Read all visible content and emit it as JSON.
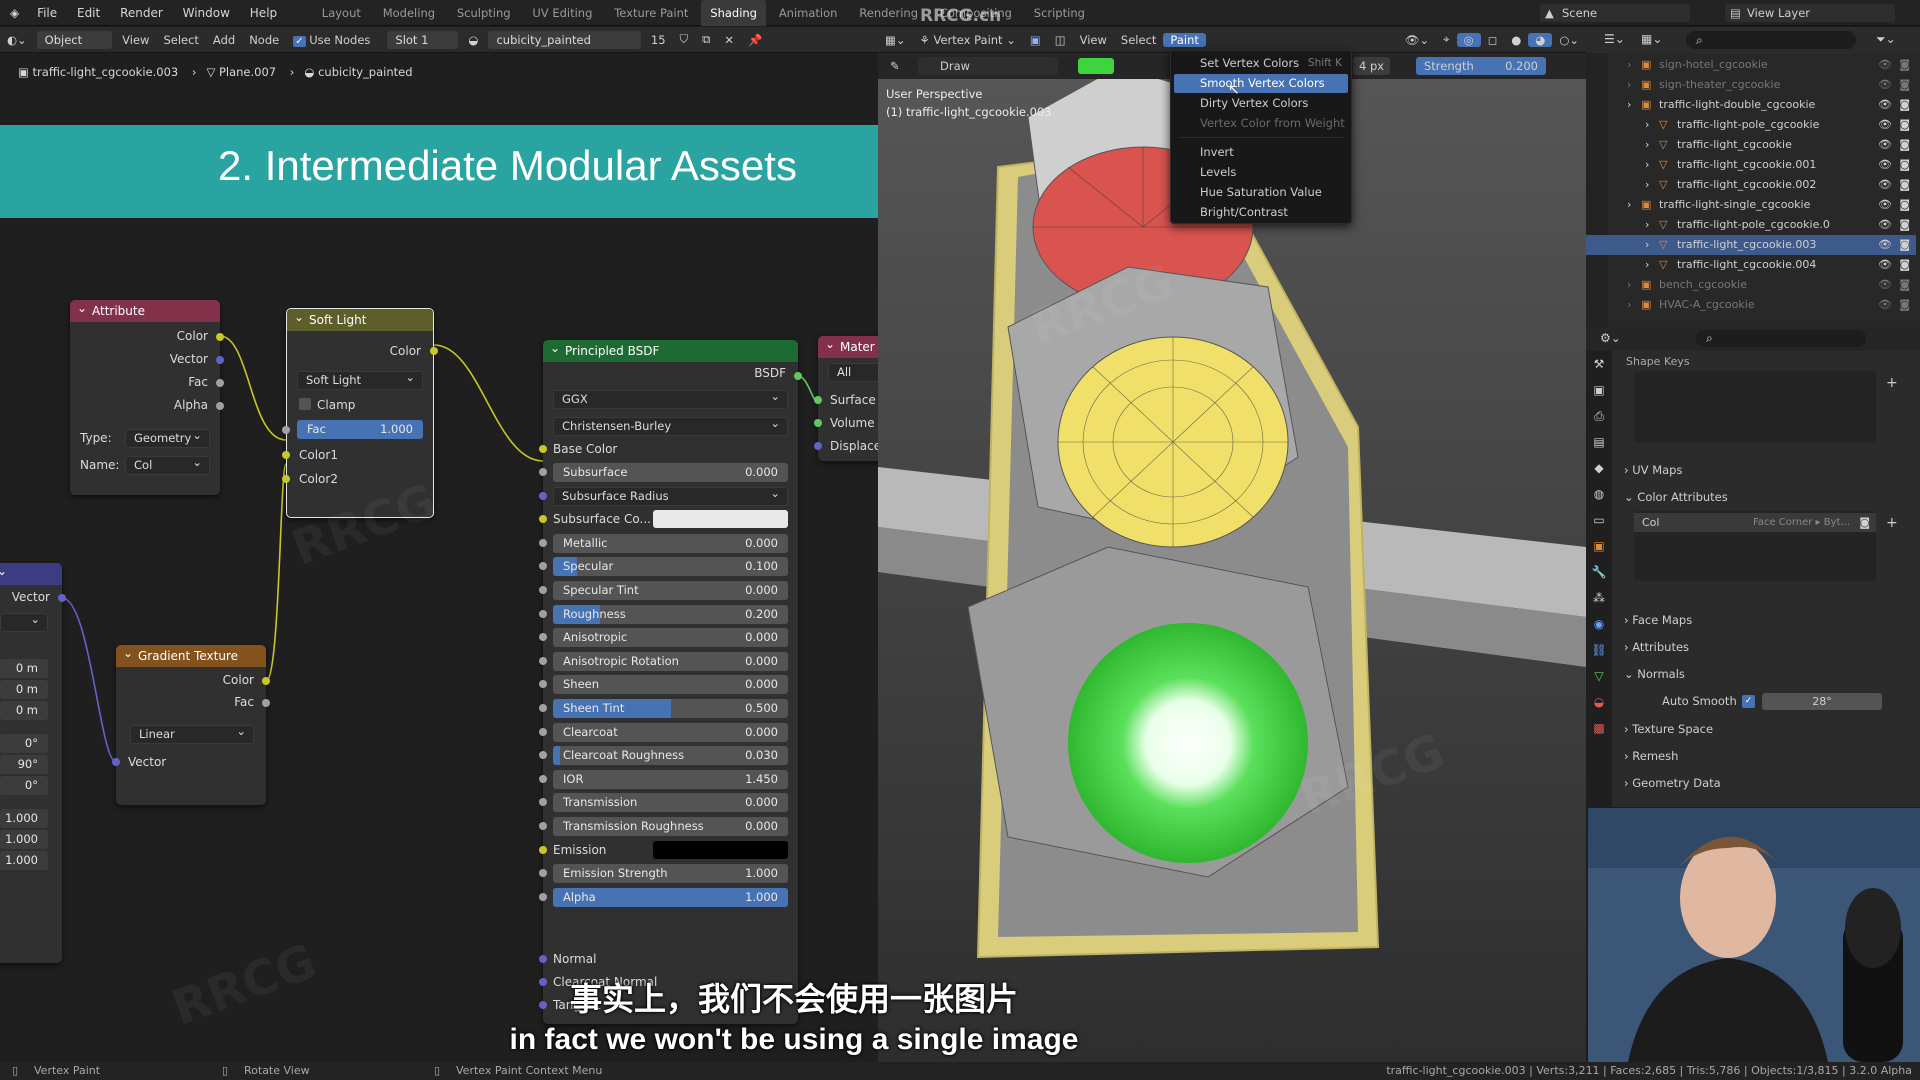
{
  "app": {
    "menus": [
      "File",
      "Edit",
      "Render",
      "Window",
      "Help"
    ],
    "workspaces": [
      "Layout",
      "Modeling",
      "Sculpting",
      "UV Editing",
      "Texture Paint",
      "Shading",
      "Animation",
      "Rendering",
      "Compositing",
      "Scripting"
    ],
    "scene": "Scene",
    "view_layer": "View Layer",
    "site_watermark": "RRCG.cn"
  },
  "node_header": {
    "mode": "Object",
    "view": "View",
    "select": "Select",
    "add": "Add",
    "node": "Node",
    "use_nodes": "Use Nodes",
    "slot": "Slot 1",
    "material": "cubicity_painted",
    "users": "15"
  },
  "breadcrumb": [
    "traffic-light_cgcookie.003",
    "Plane.007",
    "cubicity_painted"
  ],
  "banner": "2. Intermediate Modular Assets",
  "nodes": {
    "attribute": {
      "title": "Attribute",
      "outputs": [
        "Color",
        "Vector",
        "Fac",
        "Alpha"
      ],
      "type_label": "Type:",
      "type_value": "Geometry",
      "name_label": "Name:",
      "name_value": "Col"
    },
    "soft_light": {
      "title": "Soft Light",
      "output": "Color",
      "blend": "Soft Light",
      "clamp": "Clamp",
      "fac_label": "Fac",
      "fac_value": "1.000",
      "fac": 1.0,
      "inputs": [
        "Color1",
        "Color2"
      ]
    },
    "gradient": {
      "title": "Gradient Texture",
      "outputs": [
        "Color",
        "Fac"
      ],
      "type": "Linear",
      "input": "Vector"
    },
    "mapping_partial": {
      "vector": "Vector",
      "loc": [
        "0 m",
        "0 m",
        "0 m"
      ],
      "rot": [
        "0°",
        "90°",
        "0°"
      ],
      "scale": [
        "1.000",
        "1.000",
        "1.000"
      ]
    },
    "principled": {
      "title": "Principled BSDF",
      "output": "BSDF",
      "distribution": "GGX",
      "subsurface_method": "Christensen-Burley",
      "base_color": "Base Color",
      "fields": [
        {
          "label": "Subsurface",
          "value": "0.000",
          "fill": 0
        },
        {
          "label": "Subsurface Radius",
          "value": "",
          "fill": 0,
          "dropdown": true
        },
        {
          "label": "Subsurface Co...",
          "value": "",
          "fill": 0,
          "swatch": "#e8e8e8"
        },
        {
          "label": "Metallic",
          "value": "0.000",
          "fill": 0
        },
        {
          "label": "Specular",
          "value": "0.100",
          "fill": 0.1
        },
        {
          "label": "Specular Tint",
          "value": "0.000",
          "fill": 0
        },
        {
          "label": "Roughness",
          "value": "0.200",
          "fill": 0.2
        },
        {
          "label": "Anisotropic",
          "value": "0.000",
          "fill": 0
        },
        {
          "label": "Anisotropic Rotation",
          "value": "0.000",
          "fill": 0
        },
        {
          "label": "Sheen",
          "value": "0.000",
          "fill": 0
        },
        {
          "label": "Sheen Tint",
          "value": "0.500",
          "fill": 0.5
        },
        {
          "label": "Clearcoat",
          "value": "0.000",
          "fill": 0
        },
        {
          "label": "Clearcoat Roughness",
          "value": "0.030",
          "fill": 0.03
        },
        {
          "label": "IOR",
          "value": "1.450",
          "fill": 0
        },
        {
          "label": "Transmission",
          "value": "0.000",
          "fill": 0
        },
        {
          "label": "Transmission Roughness",
          "value": "0.000",
          "fill": 0
        },
        {
          "label": "Emission",
          "value": "",
          "fill": 0,
          "swatch": "#000000"
        },
        {
          "label": "Emission Strength",
          "value": "1.000",
          "fill": 0
        },
        {
          "label": "Alpha",
          "value": "1.000",
          "fill": 1
        }
      ],
      "bottom": [
        "Normal",
        "Clearcoat Normal",
        "Tangent"
      ]
    },
    "material_output": {
      "title": "Mater",
      "target": "All",
      "inputs": [
        "Surface",
        "Volume",
        "Displace"
      ]
    }
  },
  "viewport": {
    "mode": "Vertex Paint",
    "view": "View",
    "select": "Select",
    "paint": "Paint",
    "brush": "Draw",
    "radius": "4 px",
    "strength_label": "Strength",
    "strength_value": "0.200",
    "brush_color": "#3ed43e",
    "perspective": "User Perspective",
    "object": "(1) traffic-light_cgcookie.003"
  },
  "paint_menu": {
    "items": [
      {
        "label": "Set Vertex Colors",
        "shortcut": "Shift K"
      },
      {
        "label": "Smooth Vertex Colors",
        "shortcut": "",
        "active": true
      },
      {
        "label": "Dirty Vertex Colors",
        "shortcut": ""
      },
      {
        "label": "Vertex Color from Weight",
        "shortcut": "",
        "disabled": true
      },
      {
        "label": "Invert",
        "shortcut": ""
      },
      {
        "label": "Levels",
        "shortcut": ""
      },
      {
        "label": "Hue Saturation Value",
        "shortcut": ""
      },
      {
        "label": "Bright/Contrast",
        "shortcut": ""
      }
    ]
  },
  "outliner": {
    "items": [
      {
        "name": "sign-hotel_cgcookie",
        "indent": 0,
        "dim": true
      },
      {
        "name": "sign-theater_cgcookie",
        "indent": 0,
        "dim": true
      },
      {
        "name": "traffic-light-double_cgcookie",
        "indent": 0
      },
      {
        "name": "traffic-light-pole_cgcookie",
        "indent": 1
      },
      {
        "name": "traffic-light_cgcookie",
        "indent": 1
      },
      {
        "name": "traffic-light_cgcookie.001",
        "indent": 1
      },
      {
        "name": "traffic-light_cgcookie.002",
        "indent": 1
      },
      {
        "name": "traffic-light-single_cgcookie",
        "indent": 0
      },
      {
        "name": "traffic-light-pole_cgcookie.0",
        "indent": 1
      },
      {
        "name": "traffic-light_cgcookie.003",
        "indent": 1,
        "selected": true
      },
      {
        "name": "traffic-light_cgcookie.004",
        "indent": 1
      },
      {
        "name": "bench_cgcookie",
        "indent": 0,
        "dim": true
      },
      {
        "name": "HVAC-A_cgcookie",
        "indent": 0,
        "dim": true
      }
    ]
  },
  "properties": {
    "shape_keys": "Shape Keys",
    "uv_maps": "UV Maps",
    "color_attributes": "Color Attributes",
    "col_name": "Col",
    "col_domain": "Face Corner ▸ Byt...",
    "face_maps": "Face Maps",
    "attributes": "Attributes",
    "normals": "Normals",
    "auto_smooth": "Auto Smooth",
    "auto_smooth_angle": "28°",
    "texture_space": "Texture Space",
    "remesh": "Remesh",
    "geometry_data": "Geometry Data"
  },
  "subtitles": {
    "cn": "事实上，我们不会使用一张图片",
    "en": "in fact we won't be using a single image"
  },
  "statusbar": {
    "left": "Vertex Paint",
    "mid": "Rotate View",
    "right_hint": "Vertex Paint Context Menu",
    "stats": "traffic-light_cgcookie.003 | Verts:3,211 | Faces:2,685 | Tris:5,786 | Objects:1/3,815 | 3.2.0 Alpha"
  }
}
